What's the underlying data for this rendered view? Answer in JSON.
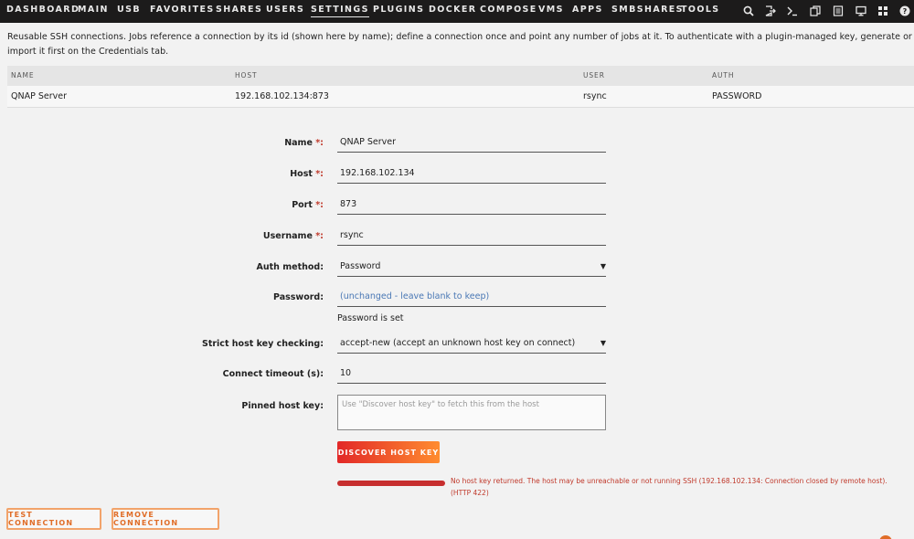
{
  "nav": {
    "tabs": [
      "DASHBOARD",
      "MAIN",
      "USB",
      "FAVORITES",
      "SHARES",
      "USERS",
      "SETTINGS",
      "PLUGINS",
      "DOCKER",
      "COMPOSE",
      "VMS",
      "APPS",
      "SMBSHARES",
      "TOOLS"
    ],
    "active_tab": "SETTINGS",
    "icons": [
      "search-icon",
      "logout-icon",
      "terminal-icon",
      "copy-icon",
      "log-icon",
      "monitor-icon",
      "apps-icon",
      "help-icon"
    ]
  },
  "intro": "Reusable SSH connections. Jobs reference a connection by its id (shown here by name); define a connection once and point any number of jobs at it. To authenticate with a plugin-managed key, generate or import it first on the Credentials tab.",
  "table": {
    "headers": [
      "NAME",
      "HOST",
      "USER",
      "AUTH"
    ],
    "rows": [
      [
        "QNAP Server",
        "192.168.102.134:873",
        "rsync",
        "PASSWORD"
      ]
    ]
  },
  "form": {
    "name_label": "Name",
    "name_value": "QNAP Server",
    "host_label": "Host",
    "host_value": "192.168.102.134",
    "port_label": "Port",
    "port_value": "873",
    "username_label": "Username",
    "username_value": "rsync",
    "auth_label": "Auth method:",
    "auth_value": "Password",
    "password_label": "Password:",
    "password_placeholder": "(unchanged - leave blank to keep)",
    "password_note": "Password is set",
    "strict_label": "Strict host key checking:",
    "strict_value": "accept-new (accept an unknown host key on connect)",
    "timeout_label": "Connect timeout (s):",
    "timeout_value": "10",
    "pinned_label": "Pinned host key:",
    "pinned_placeholder": "Use \"Discover host key\" to fetch this from the host",
    "required_mark": "*:",
    "discover_button": "DISCOVER HOST KEY",
    "error_message": "No host key returned. The host may be unreachable or not running SSH (192.168.102.134: Connection closed by remote host). (HTTP 422)"
  },
  "actions": {
    "test_button": "TEST CONNECTION",
    "remove_button": "REMOVE CONNECTION"
  },
  "colors": {
    "nav_bg": "#1c1b1b",
    "accent_orange": "#e06d28",
    "error_red": "#c0392b"
  }
}
